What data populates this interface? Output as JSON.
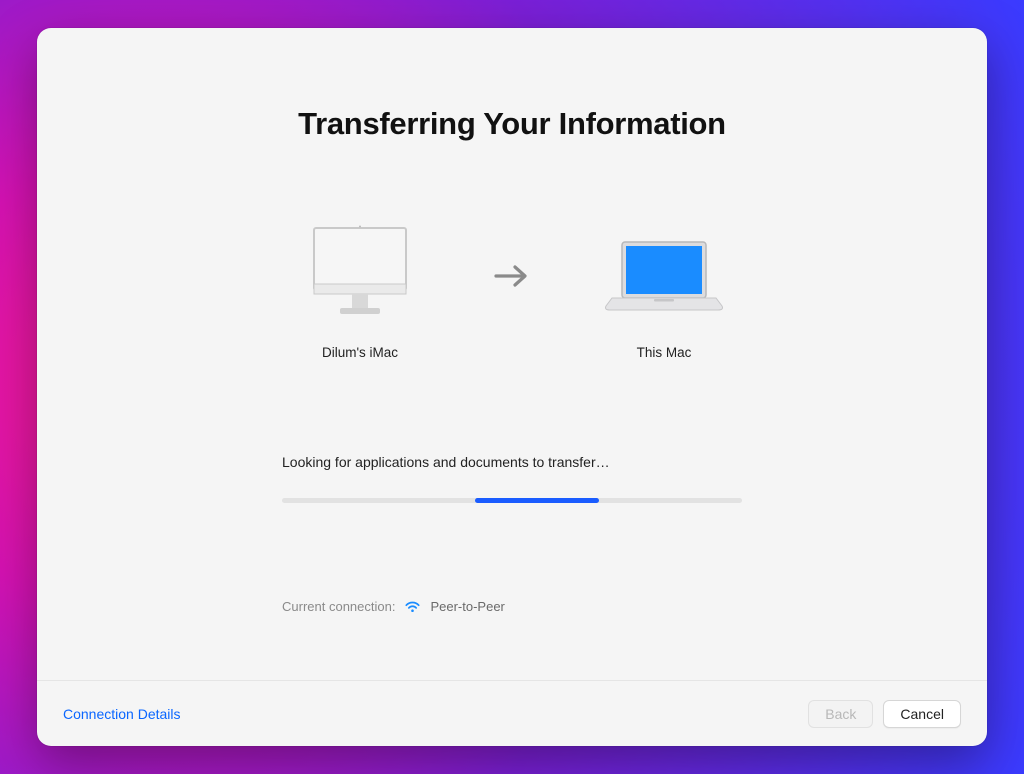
{
  "title": "Transferring Your Information",
  "source_device": {
    "label": "Dilum's iMac"
  },
  "target_device": {
    "label": "This Mac"
  },
  "status_text": "Looking for applications and documents to transfer…",
  "progress": {
    "indeterminate": true,
    "chunk_left_pct": 42,
    "chunk_width_pct": 27
  },
  "connection": {
    "label": "Current connection:",
    "type": "Peer-to-Peer",
    "icon": "wifi-icon"
  },
  "footer": {
    "details_link": "Connection Details",
    "back_label": "Back",
    "back_enabled": false,
    "cancel_label": "Cancel"
  },
  "colors": {
    "accent_blue": "#1a5cff",
    "link_blue": "#0a66ff",
    "wifi_blue": "#1a8cff",
    "macbook_screen": "#1a8cff"
  }
}
